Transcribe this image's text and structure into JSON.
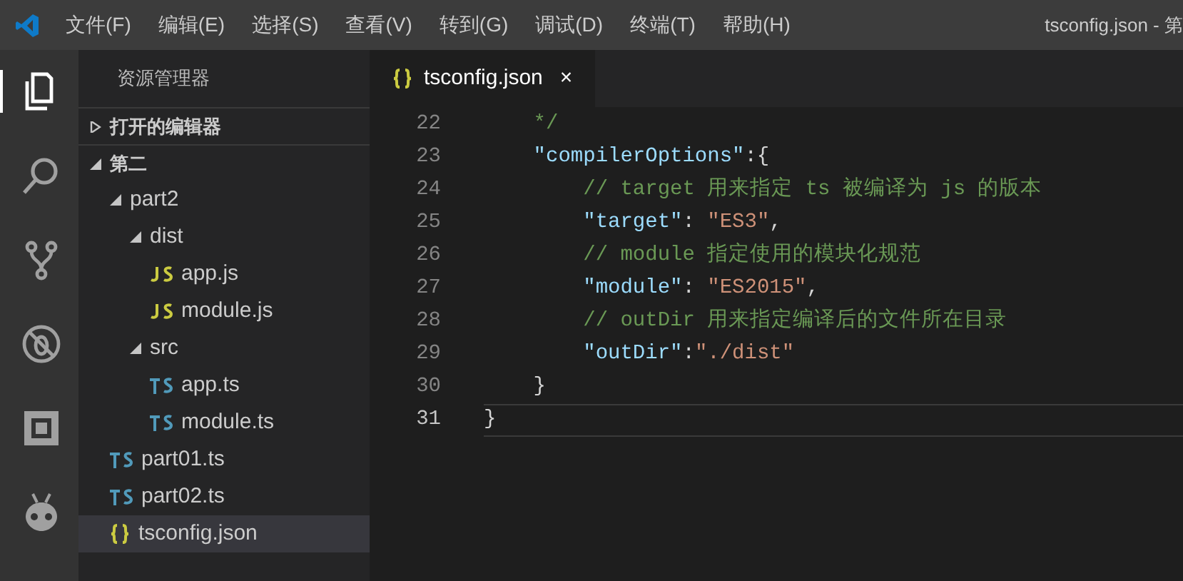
{
  "title_bar": {
    "menu": [
      "文件(F)",
      "编辑(E)",
      "选择(S)",
      "查看(V)",
      "转到(G)",
      "调试(D)",
      "终端(T)",
      "帮助(H)"
    ],
    "title": "tsconfig.json - 第"
  },
  "activity_bar": [
    {
      "kind": "files",
      "selected": true
    },
    {
      "kind": "search",
      "selected": false
    },
    {
      "kind": "git",
      "selected": false
    },
    {
      "kind": "debug",
      "selected": false
    },
    {
      "kind": "extensions",
      "selected": false
    },
    {
      "kind": "alien",
      "selected": false
    }
  ],
  "sidebar": {
    "title": "资源管理器",
    "sections": [
      {
        "label": "打开的编辑器",
        "expanded": false
      },
      {
        "label": "第二",
        "expanded": true,
        "children": [
          {
            "label": "part2",
            "kind": "folder",
            "expanded": true,
            "selected": false,
            "children": [
              {
                "label": "dist",
                "kind": "folder",
                "expanded": true,
                "selected": false,
                "children": [
                  {
                    "label": "app.js",
                    "kind": "js",
                    "selected": false
                  },
                  {
                    "label": "module.js",
                    "kind": "js",
                    "selected": false
                  }
                ]
              },
              {
                "label": "src",
                "kind": "folder",
                "expanded": true,
                "selected": false,
                "children": [
                  {
                    "label": "app.ts",
                    "kind": "ts",
                    "selected": false
                  },
                  {
                    "label": "module.ts",
                    "kind": "ts",
                    "selected": false
                  }
                ]
              }
            ]
          },
          {
            "label": "part01.ts",
            "kind": "ts",
            "selected": false
          },
          {
            "label": "part02.ts",
            "kind": "ts",
            "selected": false
          },
          {
            "label": "tsconfig.json",
            "kind": "json",
            "selected": true
          }
        ]
      }
    ]
  },
  "tabs": [
    {
      "label": "tsconfig.json",
      "kind": "json",
      "selected": true,
      "close": "×"
    }
  ],
  "editor": {
    "lines": [
      {
        "number": "22",
        "current": false,
        "tokens": [
          {
            "kind": "comment",
            "text": "    */"
          }
        ]
      },
      {
        "number": "23",
        "current": false,
        "tokens": [
          {
            "kind": "key",
            "text": "    \"compilerOptions\""
          },
          {
            "kind": "punct",
            "text": ":{"
          }
        ]
      },
      {
        "number": "24",
        "current": false,
        "tokens": [
          {
            "kind": "comment",
            "text": "        // target 用来指定 ts 被编译为 js 的版本"
          }
        ]
      },
      {
        "number": "25",
        "current": false,
        "tokens": [
          {
            "kind": "key",
            "text": "        \"target\""
          },
          {
            "kind": "punct",
            "text": ": "
          },
          {
            "kind": "string",
            "text": "\"ES3\""
          },
          {
            "kind": "punct",
            "text": ","
          }
        ]
      },
      {
        "number": "26",
        "current": false,
        "tokens": [
          {
            "kind": "comment",
            "text": "        // module 指定使用的模块化规范"
          }
        ]
      },
      {
        "number": "27",
        "current": false,
        "tokens": [
          {
            "kind": "key",
            "text": "        \"module\""
          },
          {
            "kind": "punct",
            "text": ": "
          },
          {
            "kind": "string",
            "text": "\"ES2015\""
          },
          {
            "kind": "punct",
            "text": ","
          }
        ]
      },
      {
        "number": "28",
        "current": false,
        "tokens": [
          {
            "kind": "comment",
            "text": "        // outDir 用来指定编译后的文件所在目录"
          }
        ]
      },
      {
        "number": "29",
        "current": false,
        "tokens": [
          {
            "kind": "key",
            "text": "        \"outDir\""
          },
          {
            "kind": "punct",
            "text": ":"
          },
          {
            "kind": "string",
            "text": "\"./dist\""
          }
        ]
      },
      {
        "number": "30",
        "current": false,
        "tokens": [
          {
            "kind": "punct",
            "text": "    }"
          }
        ]
      },
      {
        "number": "31",
        "current": true,
        "tokens": [
          {
            "kind": "punct",
            "text": "}"
          }
        ]
      }
    ]
  }
}
